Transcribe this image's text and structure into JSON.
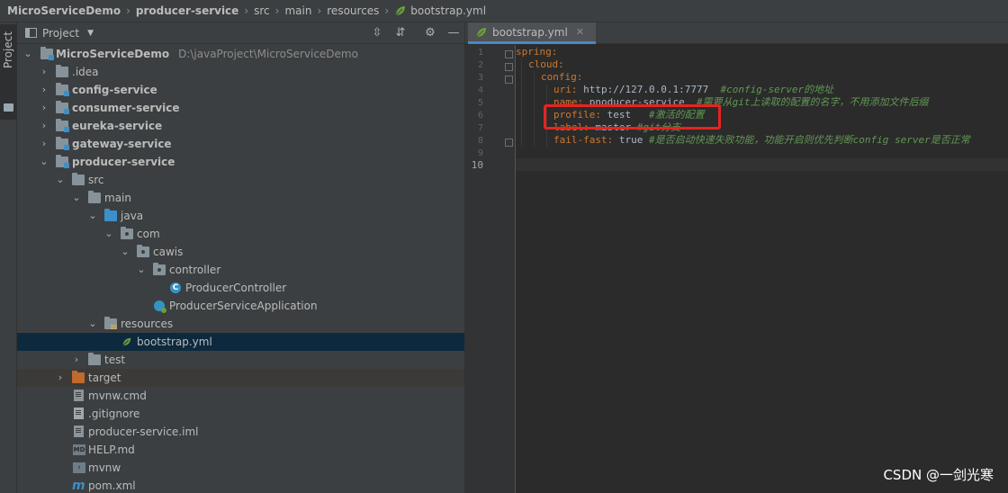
{
  "breadcrumb": {
    "items": [
      "MicroServiceDemo",
      "producer-service",
      "src",
      "main",
      "resources",
      "bootstrap.yml"
    ]
  },
  "tool_stripe": {
    "label": "Project"
  },
  "project_panel": {
    "title": "Project",
    "tree": [
      {
        "label": "MicroServiceDemo",
        "path": "D:\\javaProject\\MicroServiceDemo"
      },
      {
        "label": ".idea"
      },
      {
        "label": "config-service"
      },
      {
        "label": "consumer-service"
      },
      {
        "label": "eureka-service"
      },
      {
        "label": "gateway-service"
      },
      {
        "label": "producer-service"
      },
      {
        "label": "src"
      },
      {
        "label": "main"
      },
      {
        "label": "java"
      },
      {
        "label": "com"
      },
      {
        "label": "cawis"
      },
      {
        "label": "controller"
      },
      {
        "label": "ProducerController"
      },
      {
        "label": "ProducerServiceApplication"
      },
      {
        "label": "resources"
      },
      {
        "label": "bootstrap.yml"
      },
      {
        "label": "test"
      },
      {
        "label": "target"
      },
      {
        "label": "mvnw.cmd"
      },
      {
        "label": ".gitignore"
      },
      {
        "label": "producer-service.iml"
      },
      {
        "label": "HELP.md"
      },
      {
        "label": "mvnw"
      },
      {
        "label": "pom.xml"
      }
    ]
  },
  "editor": {
    "tab_label": "bootstrap.yml",
    "line_numbers": [
      "1",
      "2",
      "3",
      "4",
      "5",
      "6",
      "7",
      "8",
      "9",
      "10"
    ],
    "lines": [
      {
        "key": "spring:",
        "value": "",
        "comment": ""
      },
      {
        "key": "cloud:",
        "value": "",
        "comment": ""
      },
      {
        "key": "config:",
        "value": "",
        "comment": ""
      },
      {
        "key": "uri:",
        "value": " http://127.0.0.1:7777  ",
        "comment": "#config-server的地址"
      },
      {
        "key": "name:",
        "value": " pnoducer-service  ",
        "comment": "#需要从git上读取的配置的名字，不用添加文件后缀"
      },
      {
        "key": "profile:",
        "value": " test   ",
        "comment": "#激活的配置"
      },
      {
        "key": "label:",
        "value": " master ",
        "comment": "#git分支"
      },
      {
        "key": "fail-fast:",
        "value": " true ",
        "comment": "#是否启动快速失败功能，功能开启则优先判断config server是否正常"
      }
    ]
  },
  "watermark": "CSDN @一剑光寒",
  "colors": {
    "yaml_key": "#cc7832",
    "yaml_value": "#a9b7c6",
    "yaml_comment": "#629755",
    "highlight": "#e8231f",
    "selection": "#0d293e"
  }
}
